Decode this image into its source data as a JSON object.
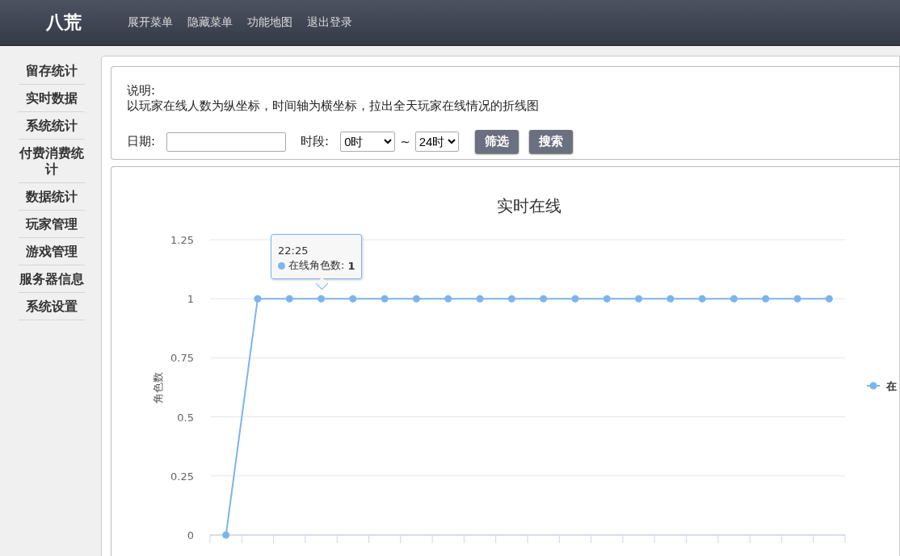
{
  "header": {
    "logo": "八荒",
    "menu": [
      "展开菜单",
      "隐藏菜单",
      "功能地图",
      "退出登录"
    ]
  },
  "sidebar": {
    "items": [
      "留存统计",
      "实时数据",
      "系统统计",
      "付费消费统计",
      "数据统计",
      "玩家管理",
      "游戏管理",
      "服务器信息",
      "系统设置"
    ]
  },
  "description": {
    "title": "说明:",
    "text": "以玩家在线人数为纵坐标，时间轴为横坐标，拉出全天玩家在线情况的折线图"
  },
  "filters": {
    "date_label": "日期:",
    "period_label": "时段:",
    "start": "0时",
    "separator": "~",
    "end": "24时",
    "buttons": [
      "筛选",
      "搜索"
    ]
  },
  "chart": {
    "tooltip": {
      "time": "22:25",
      "separator": ":",
      "value": "1"
    },
    "legend": "在",
    "chart_data": {
      "type": "line",
      "title": "实时在线",
      "ylabel": "角色数",
      "ylim": [
        0,
        1.25
      ],
      "yticks": [
        0,
        0.25,
        0.5,
        0.75,
        1,
        1.25
      ],
      "grid": true,
      "series": [
        {
          "name": "在线角色数",
          "color": "#7cb5ec",
          "marker": "circle",
          "values": [
            0,
            1,
            1,
            1,
            1,
            1,
            1,
            1,
            1,
            1,
            1,
            1,
            1,
            1,
            1,
            1,
            1,
            1,
            1,
            1
          ]
        }
      ]
    }
  }
}
